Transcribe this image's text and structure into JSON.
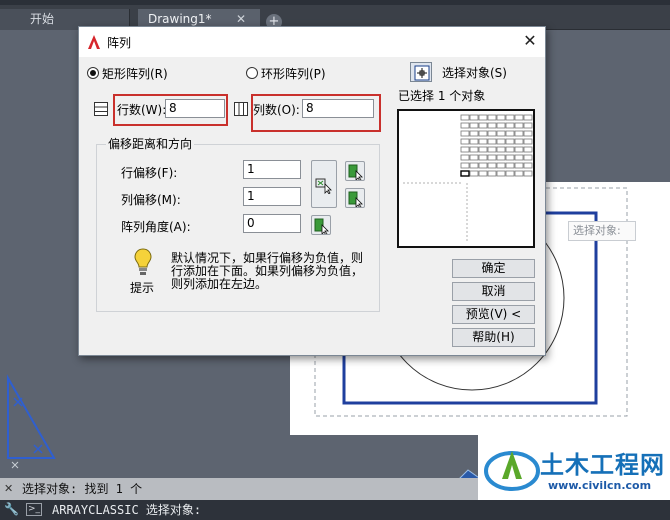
{
  "tabs": {
    "start_label": "开始",
    "drawing_label": "Drawing1*",
    "close_glyph": "✕",
    "add_glyph": "+"
  },
  "canvas": {
    "hint_text": "选择对象:"
  },
  "command_line": {
    "history": "选择对象: 找到 1 个",
    "current": "ARRAYCLASSIC 选择对象:"
  },
  "watermark": {
    "title": "土木工程网",
    "url": "www.civilcn.com"
  },
  "dialog": {
    "title": "阵列",
    "close_glyph": "✕",
    "rect_array_label": "矩形阵列(R)",
    "polar_array_label": "环形阵列(P)",
    "rect_array_selected": true,
    "rows_label": "行数(W):",
    "rows_value": "8",
    "cols_label": "列数(O):",
    "cols_value": "8",
    "offset_group_title": "偏移距离和方向",
    "row_offset_label": "行偏移(F):",
    "row_offset_value": "1",
    "col_offset_label": "列偏移(M):",
    "col_offset_value": "1",
    "angle_label": "阵列角度(A):",
    "angle_value": "0",
    "tip_label": "提示",
    "tip_text_1": "默认情况下，如果行偏移为负值，则",
    "tip_text_2": "行添加在下面。如果列偏移为负值，",
    "tip_text_3": "则列添加在左边。",
    "select_objects_label": "选择对象(S)",
    "selected_count_text": "已选择 1 个对象",
    "buttons": {
      "ok": "确定",
      "cancel": "取消",
      "preview": "预览(V) <",
      "help": "帮助(H)"
    }
  },
  "colors": {
    "accent_red": "#c9302c",
    "watermark_blue": "#1570b8",
    "drawing_blue": "#1f3f9e"
  }
}
